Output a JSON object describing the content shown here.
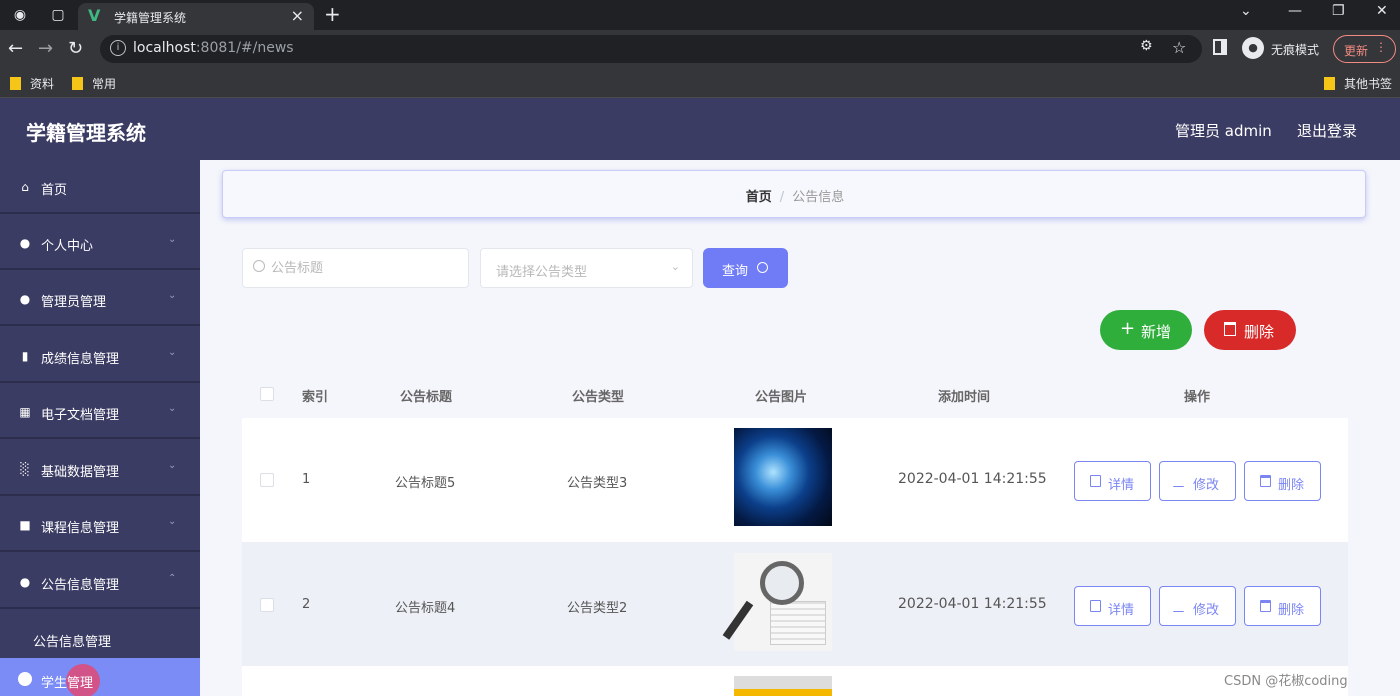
{
  "browser": {
    "tab_title": "学籍管理系统",
    "url_host": "localhost",
    "url_rest": ":8081/#/news",
    "incognito_label": "无痕模式",
    "update_label": "更新",
    "bookmarks": [
      "资料",
      "常用"
    ],
    "other_bookmarks": "其他书签"
  },
  "header": {
    "title": "学籍管理系统",
    "admin_label": "管理员 admin",
    "logout_label": "退出登录"
  },
  "sidebar": {
    "items": [
      {
        "label": "首页",
        "icon": "home-icon"
      },
      {
        "label": "个人中心",
        "icon": "user-icon"
      },
      {
        "label": "管理员管理",
        "icon": "bulb-icon"
      },
      {
        "label": "成绩信息管理",
        "icon": "mic-icon"
      },
      {
        "label": "电子文档管理",
        "icon": "document-icon"
      },
      {
        "label": "基础数据管理",
        "icon": "bar-chart-icon"
      },
      {
        "label": "课程信息管理",
        "icon": "chat-icon"
      },
      {
        "label": "公告信息管理",
        "icon": "user-group-icon"
      }
    ],
    "sub_item": "公告信息管理",
    "active_item": "学生管理"
  },
  "breadcrumb": {
    "home": "首页",
    "separator": "/",
    "current": "公告信息"
  },
  "search": {
    "title_placeholder": "公告标题",
    "type_placeholder": "请选择公告类型",
    "query_label": "查询"
  },
  "actions": {
    "add_label": "新增",
    "delete_label": "删除"
  },
  "table": {
    "columns": [
      "索引",
      "公告标题",
      "公告类型",
      "公告图片",
      "添加时间",
      "操作"
    ],
    "rows": [
      {
        "index": "1",
        "title": "公告标题5",
        "type": "公告类型3",
        "image": "globe-image",
        "time": "2022-04-01 14:21:55"
      },
      {
        "index": "2",
        "title": "公告标题4",
        "type": "公告类型2",
        "image": "news-magnifier-image",
        "time": "2022-04-01 14:21:55"
      }
    ],
    "op_labels": {
      "detail": "详情",
      "edit": "修改",
      "delete": "删除"
    }
  },
  "watermark": "CSDN @花椒coding",
  "colors": {
    "sidebar_bg": "#3b3c63",
    "accent": "#6f7cf6",
    "add_green": "#2fae3c",
    "delete_red": "#d92a2a"
  }
}
